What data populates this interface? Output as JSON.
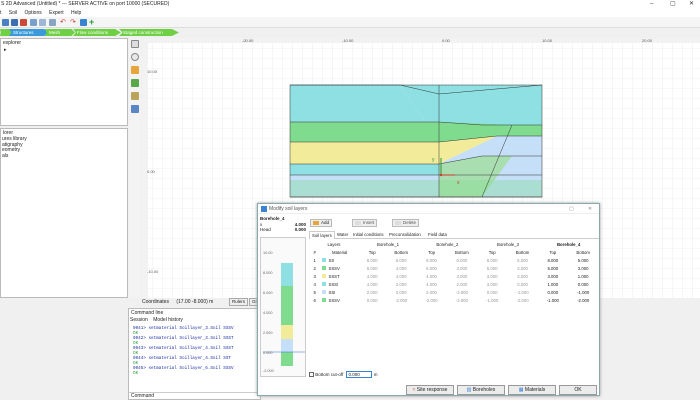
{
  "window": {
    "title": "S 2D Advanced (Untitled) * --- SERVER ACTIVE on port 10000 (SECURED)"
  },
  "menu": [
    "t",
    "Soil",
    "Options",
    "Expert",
    "Help"
  ],
  "modes": [
    "",
    "Structures",
    "Mesh",
    "Flow conditions",
    "Staged construction"
  ],
  "explorer": {
    "top_title": "explorer",
    "bottom_title": "lorer",
    "bottom_items": [
      "ures library",
      "atigraphy",
      "eometry",
      "als"
    ]
  },
  "canvas": {
    "ruler_top": [
      "-20.00",
      "-10.00",
      "0.00",
      "10.00",
      "20.00"
    ],
    "ruler_left": [
      "10.00",
      "0.00",
      "-10.00"
    ],
    "axis_y_label": "y",
    "axis_x_label": "x"
  },
  "status": {
    "coordinates_label": "Coordinates",
    "coordinates_value": "(17.00 -8.000) m",
    "rulers_button": "Rulers",
    "grid_button": "Gri"
  },
  "command": {
    "title": "Command line",
    "tabs": [
      "Session",
      "Model history"
    ],
    "lines": [
      {
        "text": "0041> setmaterial Soillayer_3.Soil SSSV",
        "ok": "OK"
      },
      {
        "text": "0042> setmaterial Soillayer_3.Soil SSST",
        "ok": "OK"
      },
      {
        "text": "0043> setmaterial Soillayer_4.Soil SSST",
        "ok": "OK"
      },
      {
        "text": "0044> setmaterial Soillayer_4.Soil SST",
        "ok": "OK"
      },
      {
        "text": "0045> setmaterial Soillayer_6.Soil SSSV",
        "ok": "OK"
      }
    ],
    "input_label": "Command"
  },
  "dialog": {
    "title": "Modify soil layers",
    "borehole_name": "Borehole_4",
    "x_label": "x",
    "x_value": "4.000",
    "head_label": "Head",
    "head_value": "0.000",
    "buttons": {
      "add": "Add",
      "insert": "Insert",
      "delete": "Delete"
    },
    "tabs": [
      "Soil layers",
      "Water",
      "Initial conditions",
      "Preconsolidation",
      "Field data"
    ],
    "column_groups": [
      "Layers",
      "Borehole_1",
      "Borehole_2",
      "Borehole_3",
      "Borehole_4"
    ],
    "sub_headers": [
      "#",
      "Material",
      "Top",
      "Bottom",
      "Top",
      "Bottom",
      "Top",
      "Bottom",
      "Top",
      "Bottom"
    ],
    "rows": [
      {
        "n": "1",
        "mat": "SS",
        "color": "#8ee0e3",
        "v": [
          "8.000",
          "6.000",
          "8.000",
          "6.000",
          "8.000",
          "5.000",
          "8.000",
          "5.000"
        ]
      },
      {
        "n": "2",
        "mat": "SSSV",
        "color": "#7fdc8f",
        "v": [
          "6.000",
          "4.000",
          "6.000",
          "4.000",
          "5.000",
          "3.000",
          "5.000",
          "3.000"
        ]
      },
      {
        "n": "3",
        "mat": "SSST",
        "color": "#f2ec9a",
        "v": [
          "4.000",
          "4.000",
          "4.000",
          "4.000",
          "3.000",
          "3.000",
          "3.000",
          "1.000"
        ]
      },
      {
        "n": "4",
        "mat": "SSSI",
        "color": "#8ee0e3",
        "v": [
          "4.000",
          "2.000",
          "4.000",
          "2.000",
          "3.000",
          "0.000",
          "1.000",
          "0.000"
        ]
      },
      {
        "n": "5",
        "mat": "SSI",
        "color": "#c4dff7",
        "v": [
          "2.000",
          "0.000",
          "2.000",
          "-2.000",
          "0.000",
          "-1.000",
          "0.000",
          "-1.000"
        ]
      },
      {
        "n": "6",
        "mat": "SSSV",
        "color": "#7fdc8f",
        "v": [
          "0.000",
          "-2.000",
          "-2.000",
          "-2.000",
          "-1.000",
          "-2.000",
          "-1.000",
          "-2.000"
        ]
      }
    ],
    "column_scale": [
      "10.00",
      "8.000",
      "6.000",
      "4.000",
      "2.000",
      "0.000",
      "-2.000"
    ],
    "bottom_cutoff_label": "Bottom cut-off",
    "bottom_cutoff_value": "0.000",
    "bottom_cutoff_unit": "m",
    "footer": {
      "site_response": "Site response",
      "boreholes": "Boreholes",
      "materials": "Materials",
      "ok": "OK"
    }
  },
  "colors": {
    "cyan": "#8ee0e3",
    "green": "#7fdc8f",
    "yellow": "#f2ec9a",
    "lightblue": "#c4dff7",
    "mode_active": "#3a9ad9",
    "mode_inactive": "#6fcf45"
  }
}
